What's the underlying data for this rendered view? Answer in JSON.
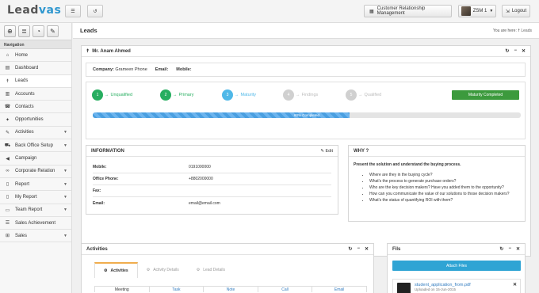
{
  "app": {
    "logo_main": "Lead",
    "logo_accent": "vas"
  },
  "topbar": {
    "crm_label": "Customer Relationship Management",
    "user_label": "ZSM 1",
    "logout_label": "Logout"
  },
  "sidebar": {
    "section": "Navigation",
    "items": [
      {
        "label": "Home",
        "icon": "home-icon"
      },
      {
        "label": "Dashboard",
        "icon": "dashboard-icon"
      },
      {
        "label": "Leads",
        "icon": "person-icon"
      },
      {
        "label": "Accounts",
        "icon": "bank-icon"
      },
      {
        "label": "Contacts",
        "icon": "phone-icon"
      },
      {
        "label": "Opportunities",
        "icon": "bulb-icon"
      },
      {
        "label": "Activities",
        "icon": "edit-icon"
      },
      {
        "label": "Back Office Setup",
        "icon": "truck-icon"
      },
      {
        "label": "Campaign",
        "icon": "megaphone-icon"
      },
      {
        "label": "Corporate Relation",
        "icon": "link-icon"
      },
      {
        "label": "Report",
        "icon": "doc-icon"
      },
      {
        "label": "My Report",
        "icon": "doc-icon"
      },
      {
        "label": "Team Report",
        "icon": "team-doc-icon"
      },
      {
        "label": "Sales Achievement",
        "icon": "list-icon"
      },
      {
        "label": "Sales",
        "icon": "cart-icon"
      }
    ]
  },
  "header": {
    "title": "Leads",
    "crumb_prefix": "You are here:",
    "crumb_current": "Leads"
  },
  "lead": {
    "name": "Mr. Anam Ahmed",
    "company_label": "Company:",
    "company_value": "Grameen Phone",
    "email_label": "Email:",
    "mobile_label": "Mobile:",
    "steps": [
      {
        "num": "1",
        "label": "Unqualified",
        "state": "done"
      },
      {
        "num": "2",
        "label": "Primary",
        "state": "done"
      },
      {
        "num": "3",
        "label": "Maturity",
        "state": "current"
      },
      {
        "num": "4",
        "label": "Findings",
        "state": "todo"
      },
      {
        "num": "5",
        "label": "Qualified",
        "state": "todo"
      }
    ],
    "status_button": "Maturity Completed",
    "progress_label": "60% Completed",
    "progress_value": 0.6
  },
  "information": {
    "title": "INFORMATION",
    "edit_label": "Edit",
    "rows": [
      {
        "label": "Mobile:",
        "value": "0191000000"
      },
      {
        "label": "Office Phone:",
        "value": "+8802000000"
      },
      {
        "label": "Fax:",
        "value": ""
      },
      {
        "label": "Email:",
        "value": "email@email.com"
      }
    ]
  },
  "why": {
    "title": "WHY ?",
    "intro": "Present the solution and understand the buying process.",
    "points": [
      "Where are they in the buying cycle?",
      "What's the process to generate purchase orders?",
      "Who are the key decision makers? Have you added them to the opportunity?",
      "How can you communicate the value of our solutions to those decision makers?",
      "What's the status of quantifying ROI with them?"
    ]
  },
  "activities": {
    "title": "Activities",
    "tabs": [
      "Activities",
      "Activity Details",
      "Lead Details"
    ],
    "columns": [
      "Meeting",
      "Task",
      "Note",
      "Call",
      "Email"
    ]
  },
  "files": {
    "title": "Fils",
    "attach_label": "Attach Files",
    "file_name": "student_application_from.pdf",
    "file_meta": "Uploaded on 15-Jun-2015"
  },
  "colors": {
    "brand": "#2f97cf",
    "done": "#27ae60",
    "current": "#4fb8e8",
    "status_button": "#3c9a3d",
    "attach": "#2fa4d4"
  }
}
